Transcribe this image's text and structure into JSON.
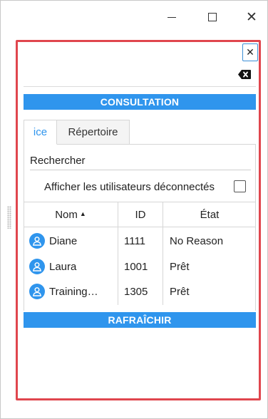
{
  "window": {
    "minimize_glyph": "—",
    "close_glyph": "✕"
  },
  "panel": {
    "close_glyph": "✕",
    "icons": {
      "close": "close-icon",
      "backspace": "backspace-icon",
      "user": "user-icon"
    },
    "consultation_label": "CONSULTATION",
    "refresh_label": "RAFRAÎCHIR",
    "accent_color": "#2f95ed",
    "highlight_color": "#e0464e"
  },
  "tabs": [
    {
      "label": "ice",
      "active": true
    },
    {
      "label": "Répertoire",
      "active": false
    }
  ],
  "search": {
    "placeholder": "Rechercher",
    "value": ""
  },
  "filter": {
    "label": "Afficher les utilisateurs déconnectés",
    "checked": false
  },
  "table": {
    "columns": [
      {
        "label": "Nom",
        "sort": "ascending",
        "sort_glyph": "▲"
      },
      {
        "label": "ID"
      },
      {
        "label": "État"
      }
    ],
    "rows": [
      {
        "name": "Diane",
        "id": "1111",
        "state": "No Reason"
      },
      {
        "name": "Laura",
        "id": "1001",
        "state": "Prêt"
      },
      {
        "name": "Training…",
        "id": "1305",
        "state": "Prêt"
      }
    ]
  }
}
